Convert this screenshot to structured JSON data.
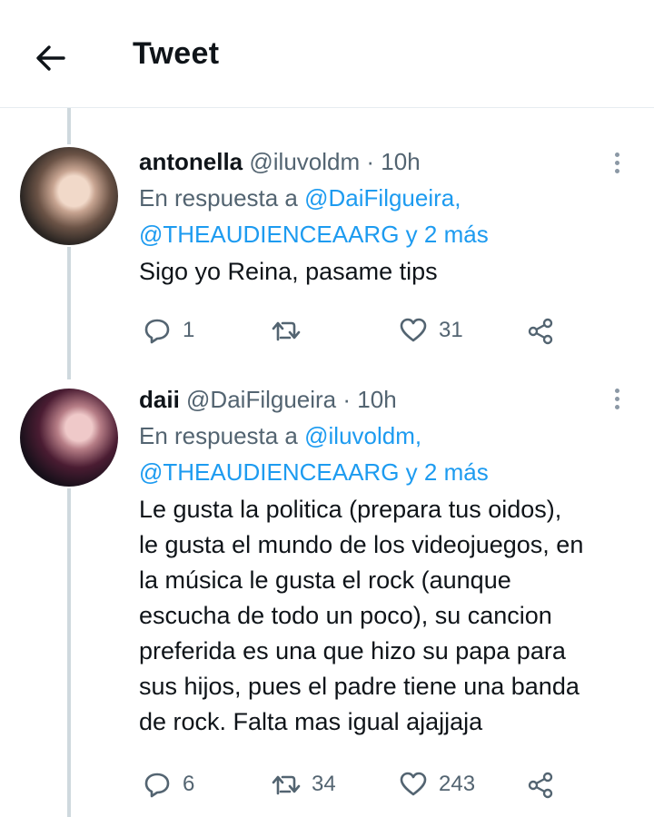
{
  "header": {
    "title": "Tweet"
  },
  "tweets": [
    {
      "display_name": "antonella",
      "handle": "@iluvoldm",
      "sep": "·",
      "time": "10h",
      "reply_prefix": "En respuesta a",
      "reply_to_1": "@DaiFilgueira,",
      "reply_to_2": "@THEAUDIENCEAARG",
      "reply_more": "y 2 más",
      "text": "Sigo yo Reina, pasame tips",
      "replies": "1",
      "retweets": "",
      "likes": "31"
    },
    {
      "display_name": "daii",
      "handle": "@DaiFilgueira",
      "sep": "·",
      "time": "10h",
      "reply_prefix": "En respuesta a",
      "reply_to_1": "@iluvoldm,",
      "reply_to_2": "@THEAUDIENCEAARG",
      "reply_more": "y 2 más",
      "text_lines": [
        "Le gusta la politica (prepara tus oidos),",
        "le gusta el mundo de los videojuegos, en",
        "la música le gusta el rock (aunque",
        "escucha de todo un poco), su cancion",
        "preferida es una que hizo su papa para",
        "sus hijos, pues el padre tiene una banda",
        "de rock. Falta mas igual ajajjaja"
      ],
      "replies": "6",
      "retweets": "34",
      "likes": "243"
    }
  ],
  "colors": {
    "link": "#1d9bf0",
    "muted": "#536471",
    "text": "#0f1419",
    "thread_line": "#cfd9de"
  },
  "icons": [
    "back-arrow-icon",
    "more-vertical-icon",
    "reply-icon",
    "retweet-icon",
    "like-icon",
    "share-icon"
  ]
}
